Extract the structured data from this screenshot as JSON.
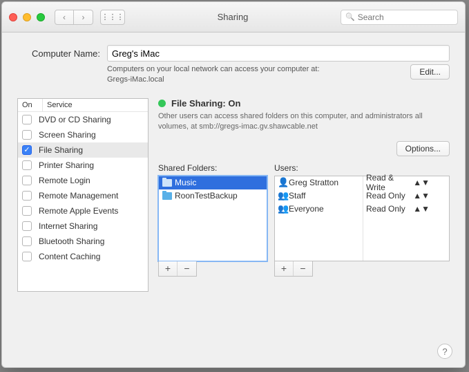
{
  "window": {
    "title": "Sharing"
  },
  "search": {
    "placeholder": "Search"
  },
  "computerName": {
    "label": "Computer Name:",
    "value": "Greg's iMac",
    "sub1": "Computers on your local network can access your computer at:",
    "sub2": "Gregs-iMac.local",
    "edit": "Edit..."
  },
  "services": {
    "header_on": "On",
    "header_service": "Service",
    "items": [
      {
        "label": "DVD or CD Sharing",
        "checked": false
      },
      {
        "label": "Screen Sharing",
        "checked": false
      },
      {
        "label": "File Sharing",
        "checked": true
      },
      {
        "label": "Printer Sharing",
        "checked": false
      },
      {
        "label": "Remote Login",
        "checked": false
      },
      {
        "label": "Remote Management",
        "checked": false
      },
      {
        "label": "Remote Apple Events",
        "checked": false
      },
      {
        "label": "Internet Sharing",
        "checked": false
      },
      {
        "label": "Bluetooth Sharing",
        "checked": false
      },
      {
        "label": "Content Caching",
        "checked": false
      }
    ]
  },
  "status": {
    "title": "File Sharing: On",
    "desc": "Other users can access shared folders on this computer, and administrators all volumes, at smb://gregs-imac.gv.shawcable.net",
    "options": "Options..."
  },
  "folders": {
    "title": "Shared Folders:",
    "items": [
      {
        "label": "Music",
        "selected": true
      },
      {
        "label": "RoonTestBackup",
        "selected": false
      }
    ]
  },
  "users": {
    "title": "Users:",
    "items": [
      {
        "icon": "👤",
        "name": "Greg Stratton",
        "perm": "Read & Write"
      },
      {
        "icon": "👥",
        "name": "Staff",
        "perm": "Read Only"
      },
      {
        "icon": "👥",
        "name": "Everyone",
        "perm": "Read Only"
      }
    ]
  },
  "glyphs": {
    "plus": "+",
    "minus": "−",
    "back": "‹",
    "fwd": "›",
    "grid": "⋮⋮⋮",
    "help": "?",
    "check": "✓",
    "search": "🔍"
  }
}
